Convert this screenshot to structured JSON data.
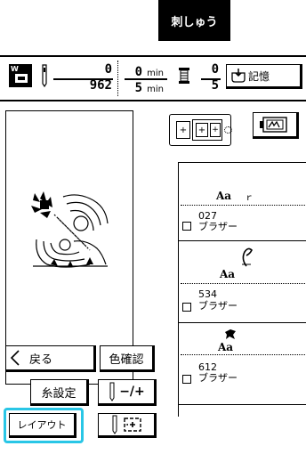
{
  "mode_tab": "刺しゅう",
  "status": {
    "stitch_current": "0",
    "stitch_total": "962",
    "time_current": "0",
    "time_total": "5",
    "time_unit": "min",
    "color_current": "0",
    "color_total": "5",
    "memory_label": "記憶"
  },
  "buttons": {
    "back": "戻る",
    "color_check": "色確認",
    "thread_setting": "糸設定",
    "minus_plus": "−/+",
    "layout": "レイアウト"
  },
  "threads": [
    {
      "sample": "Aa",
      "number": "027",
      "name": "ブラザー"
    },
    {
      "sample": "Aa",
      "number": "534",
      "name": "ブラザー"
    },
    {
      "sample": "Aa",
      "number": "612",
      "name": "ブラザー"
    }
  ]
}
